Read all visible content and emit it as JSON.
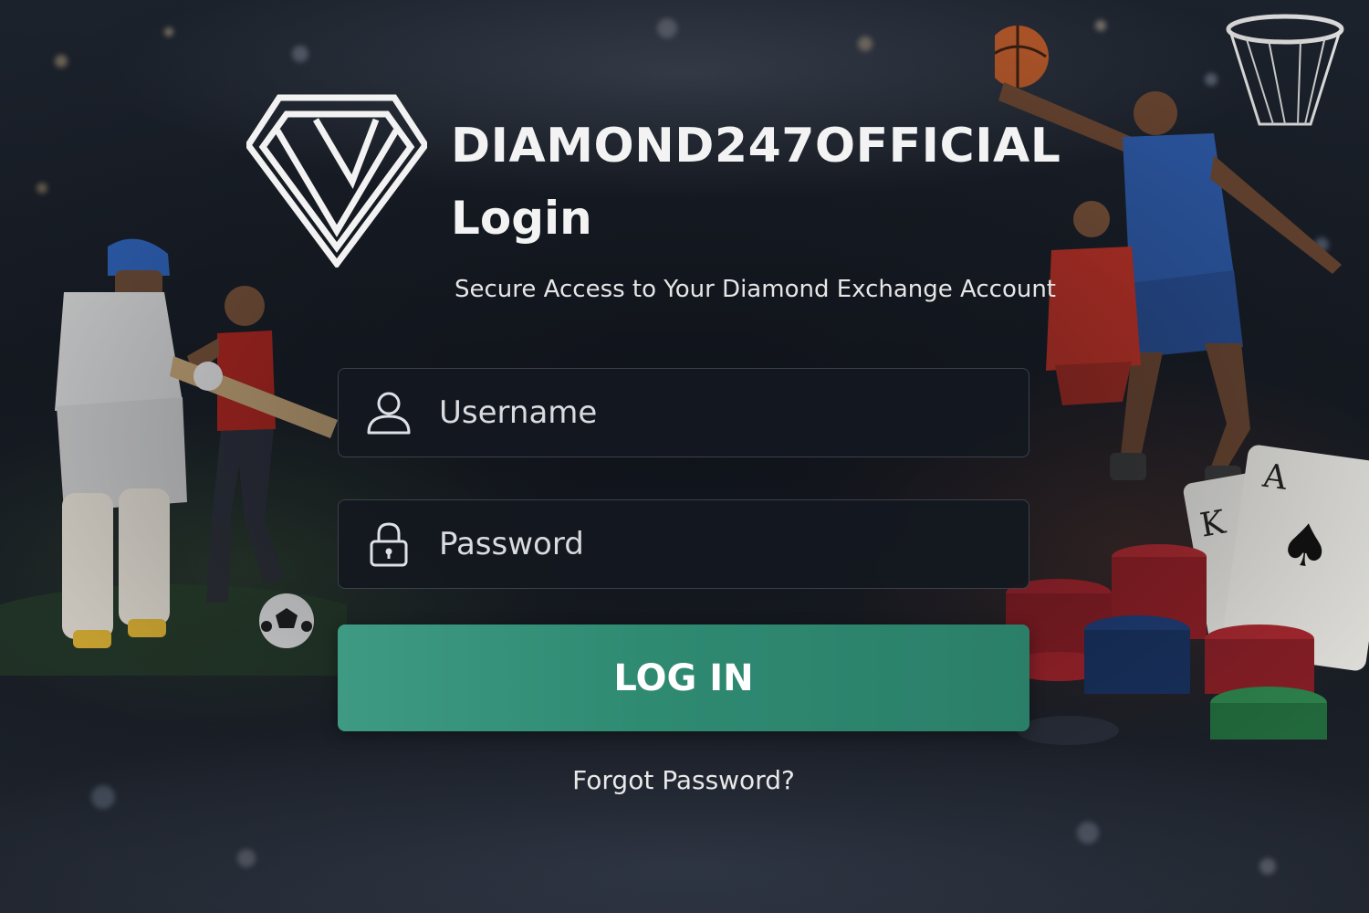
{
  "brand": {
    "name": "DIAMOND247OFFICIAL",
    "logo_icon": "diamond-logo-icon"
  },
  "page": {
    "heading": "Login",
    "subtitle": "Secure Access to Your Diamond Exchange Account"
  },
  "form": {
    "username": {
      "placeholder": "Username",
      "value": "",
      "icon": "user-icon"
    },
    "password": {
      "placeholder": "Password",
      "value": "",
      "icon": "lock-icon"
    },
    "submit_label": "LOG IN",
    "forgot_label": "Forgot Password?"
  },
  "colors": {
    "accent": "#2f8a72",
    "background": "#161b23",
    "field_background": "#141820",
    "text": "#f3f3f3"
  },
  "background_scene": [
    "cricket-batsman",
    "football-player",
    "basketball-player",
    "poker-chips",
    "playing-cards"
  ]
}
